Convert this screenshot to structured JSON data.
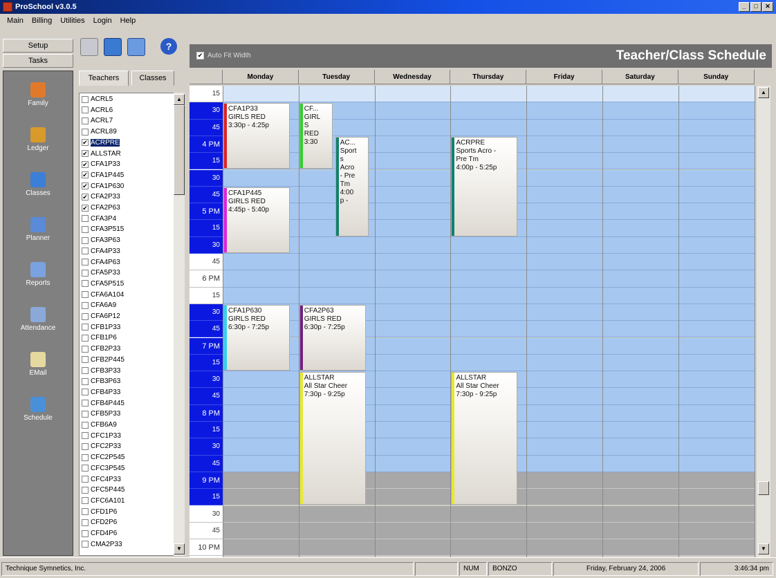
{
  "window": {
    "title": "ProSchool v3.0.5"
  },
  "menu": [
    "Main",
    "Billing",
    "Utilities",
    "Login",
    "Help"
  ],
  "left_buttons": {
    "setup": "Setup",
    "tasks": "Tasks"
  },
  "nav_items": [
    {
      "label": "Family",
      "icon": "family-icon",
      "color": "#e07a2a"
    },
    {
      "label": "Ledger",
      "icon": "ledger-icon",
      "color": "#d89b2b"
    },
    {
      "label": "Classes",
      "icon": "classes-icon",
      "color": "#3c7fd6"
    },
    {
      "label": "Planner",
      "icon": "planner-icon",
      "color": "#5a8ad8"
    },
    {
      "label": "Reports",
      "icon": "reports-icon",
      "color": "#7aa2e0"
    },
    {
      "label": "Attendance",
      "icon": "attendance-icon",
      "color": "#8aa9d9"
    },
    {
      "label": "EMail",
      "icon": "email-icon",
      "color": "#e6d9a0"
    },
    {
      "label": "Schedule",
      "icon": "schedule-icon",
      "color": "#4a90d9"
    }
  ],
  "tabs": {
    "teachers": "Teachers",
    "classes": "Classes"
  },
  "class_list": [
    {
      "name": "ACRL5",
      "checked": false
    },
    {
      "name": "ACRL6",
      "checked": false
    },
    {
      "name": "ACRL7",
      "checked": false
    },
    {
      "name": "ACRL89",
      "checked": false
    },
    {
      "name": "ACRPRE",
      "checked": true,
      "selected": true
    },
    {
      "name": "ALLSTAR",
      "checked": true
    },
    {
      "name": "CFA1P33",
      "checked": true
    },
    {
      "name": "CFA1P445",
      "checked": true
    },
    {
      "name": "CFA1P630",
      "checked": true
    },
    {
      "name": "CFA2P33",
      "checked": true
    },
    {
      "name": "CFA2P63",
      "checked": true
    },
    {
      "name": "CFA3P4",
      "checked": false
    },
    {
      "name": "CFA3P515",
      "checked": false
    },
    {
      "name": "CFA3P63",
      "checked": false
    },
    {
      "name": "CFA4P33",
      "checked": false
    },
    {
      "name": "CFA4P63",
      "checked": false
    },
    {
      "name": "CFA5P33",
      "checked": false
    },
    {
      "name": "CFA5P515",
      "checked": false
    },
    {
      "name": "CFA6A104",
      "checked": false
    },
    {
      "name": "CFA6A9",
      "checked": false
    },
    {
      "name": "CFA6P12",
      "checked": false
    },
    {
      "name": "CFB1P33",
      "checked": false
    },
    {
      "name": "CFB1P6",
      "checked": false
    },
    {
      "name": "CFB2P33",
      "checked": false
    },
    {
      "name": "CFB2P445",
      "checked": false
    },
    {
      "name": "CFB3P33",
      "checked": false
    },
    {
      "name": "CFB3P63",
      "checked": false
    },
    {
      "name": "CFB4P33",
      "checked": false
    },
    {
      "name": "CFB4P445",
      "checked": false
    },
    {
      "name": "CFB5P33",
      "checked": false
    },
    {
      "name": "CFB6A9",
      "checked": false
    },
    {
      "name": "CFC1P33",
      "checked": false
    },
    {
      "name": "CFC2P33",
      "checked": false
    },
    {
      "name": "CFC2P545",
      "checked": false
    },
    {
      "name": "CFC3P545",
      "checked": false
    },
    {
      "name": "CFC4P33",
      "checked": false
    },
    {
      "name": "CFC5P445",
      "checked": false
    },
    {
      "name": "CFC6A101",
      "checked": false
    },
    {
      "name": "CFD1P6",
      "checked": false
    },
    {
      "name": "CFD2P6",
      "checked": false
    },
    {
      "name": "CFD4P6",
      "checked": false
    },
    {
      "name": "CMA2P33",
      "checked": false
    }
  ],
  "schedule": {
    "auto_fit_label": "Auto Fit Width",
    "auto_fit_checked": true,
    "title": "Teacher/Class Schedule",
    "days": [
      "Monday",
      "Tuesday",
      "Wednesday",
      "Thursday",
      "Friday",
      "Saturday",
      "Sunday"
    ],
    "time_slots": [
      {
        "label": "15",
        "hl": false,
        "zone": "white"
      },
      {
        "label": "30",
        "hl": true,
        "zone": "blue"
      },
      {
        "label": "45",
        "hl": true,
        "zone": "blue"
      },
      {
        "label": "4 PM",
        "hl": true,
        "zone": "blue"
      },
      {
        "label": "15",
        "hl": true,
        "zone": "blue"
      },
      {
        "label": "30",
        "hl": true,
        "zone": "blue"
      },
      {
        "label": "45",
        "hl": true,
        "zone": "blue"
      },
      {
        "label": "5 PM",
        "hl": true,
        "zone": "blue"
      },
      {
        "label": "15",
        "hl": true,
        "zone": "blue"
      },
      {
        "label": "30",
        "hl": true,
        "zone": "blue"
      },
      {
        "label": "45",
        "hl": false,
        "zone": "blue"
      },
      {
        "label": "6 PM",
        "hl": false,
        "zone": "blue"
      },
      {
        "label": "15",
        "hl": false,
        "zone": "blue"
      },
      {
        "label": "30",
        "hl": true,
        "zone": "blue"
      },
      {
        "label": "45",
        "hl": true,
        "zone": "blue"
      },
      {
        "label": "7 PM",
        "hl": true,
        "zone": "blue"
      },
      {
        "label": "15",
        "hl": true,
        "zone": "blue"
      },
      {
        "label": "30",
        "hl": true,
        "zone": "blue"
      },
      {
        "label": "45",
        "hl": true,
        "zone": "blue"
      },
      {
        "label": "8 PM",
        "hl": true,
        "zone": "blue"
      },
      {
        "label": "15",
        "hl": true,
        "zone": "blue"
      },
      {
        "label": "30",
        "hl": true,
        "zone": "blue"
      },
      {
        "label": "45",
        "hl": true,
        "zone": "blue"
      },
      {
        "label": "9 PM",
        "hl": true,
        "zone": "gray"
      },
      {
        "label": "15",
        "hl": true,
        "zone": "gray"
      },
      {
        "label": "30",
        "hl": false,
        "zone": "gray"
      },
      {
        "label": "45",
        "hl": false,
        "zone": "gray"
      },
      {
        "label": "10 PM",
        "hl": false,
        "zone": "gray"
      }
    ],
    "events": [
      {
        "day": 0,
        "lane": 0,
        "lanes": 1,
        "start": 1,
        "span": 4,
        "lines": [
          "CFA1P33",
          "GIRLS RED",
          "3:30p - 4:25p"
        ],
        "color": "#e02020"
      },
      {
        "day": 0,
        "lane": 0,
        "lanes": 1,
        "start": 6,
        "span": 4,
        "lines": [
          "CFA1P445",
          "GIRLS RED",
          "4:45p - 5:40p"
        ],
        "color": "#e020e0"
      },
      {
        "day": 0,
        "lane": 0,
        "lanes": 1,
        "start": 13,
        "span": 4,
        "lines": [
          "CFA1P630",
          "GIRLS RED",
          "6:30p - 7:25p"
        ],
        "color": "#30d0f0"
      },
      {
        "day": 1,
        "lane": 0,
        "lanes": 2,
        "start": 1,
        "span": 4,
        "lines": [
          "CF...",
          "GIRL",
          "S",
          "RED",
          "3:30"
        ],
        "color": "#30d030"
      },
      {
        "day": 1,
        "lane": 1,
        "lanes": 2,
        "start": 3,
        "span": 6,
        "lines": [
          "AC...",
          "Sport",
          "s",
          "Acro",
          "- Pre",
          "Tm",
          "4:00",
          "p -"
        ],
        "color": "#108070"
      },
      {
        "day": 1,
        "lane": 0,
        "lanes": 1,
        "start": 13,
        "span": 4,
        "lines": [
          "CFA2P63",
          "GIRLS RED",
          "6:30p - 7:25p"
        ],
        "color": "#702080"
      },
      {
        "day": 1,
        "lane": 0,
        "lanes": 1,
        "start": 17,
        "span": 8,
        "lines": [
          "ALLSTAR",
          "All Star Cheer",
          "7:30p - 9:25p"
        ],
        "color": "#e8e830"
      },
      {
        "day": 3,
        "lane": 0,
        "lanes": 1,
        "start": 3,
        "span": 6,
        "lines": [
          "ACRPRE",
          "Sports Acro -",
          "Pre Tm",
          "4:00p - 5:25p"
        ],
        "color": "#108070"
      },
      {
        "day": 3,
        "lane": 0,
        "lanes": 1,
        "start": 17,
        "span": 8,
        "lines": [
          "ALLSTAR",
          "All Star Cheer",
          "7:30p - 9:25p"
        ],
        "color": "#e8e830"
      }
    ]
  },
  "status": {
    "company": "Technique Symnetics, Inc.",
    "num": "NUM",
    "user": "BONZO",
    "date": "Friday, February 24, 2006",
    "time": "3:46:34 pm"
  }
}
